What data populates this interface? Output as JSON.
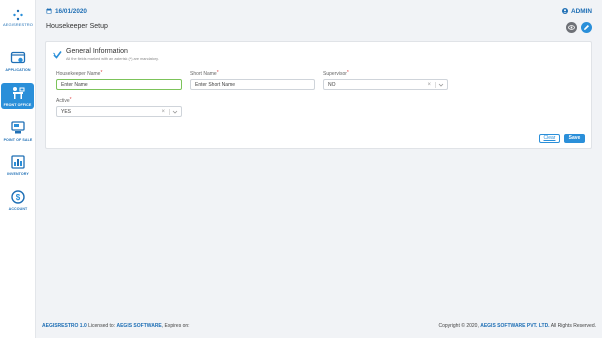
{
  "brand": {
    "name": "AEGISRESTRO"
  },
  "sidebar": {
    "items": [
      {
        "label": "APPLICATION",
        "icon": "application-window-icon",
        "active": false
      },
      {
        "label": "FRONT OFFICE",
        "icon": "front-office-desk-icon",
        "active": true
      },
      {
        "label": "POINT OF SALE",
        "icon": "pos-terminal-icon",
        "active": false
      },
      {
        "label": "INVENTORY",
        "icon": "inventory-chart-icon",
        "active": false
      },
      {
        "label": "ACCOUNT",
        "icon": "account-dollar-icon",
        "active": false
      }
    ]
  },
  "header": {
    "date": "16/01/2020",
    "user": "ADMIN",
    "page_title": "Housekeeper Setup"
  },
  "form": {
    "section_title": "General Information",
    "section_note": "All the fields marked with an asterisk (*) are mandatory.",
    "fields": {
      "housekeeper_name": {
        "label": "Housekeeper Name",
        "placeholder": "Enter Name",
        "required": "*"
      },
      "short_name": {
        "label": "Short Name",
        "placeholder": "Enter Short Name",
        "required": "*"
      },
      "supervisor": {
        "label": "Supervisor",
        "value": "NO",
        "required": "*"
      },
      "active": {
        "label": "Active",
        "value": "YES",
        "required": "*"
      }
    },
    "buttons": {
      "clear": "Clear",
      "save": "Save"
    }
  },
  "footer": {
    "product": "AEGISRESTRO 1.0",
    "licensed_text": "Licensed to:",
    "licensee": "AEGIS SOFTWARE",
    "expires_text": ", Expires on:",
    "copyright_text": "Copyright © 2020,",
    "company": "AEGIS SOFTWARE PVT. LTD.",
    "rights_text": "All Rights Reserved."
  },
  "colors": {
    "accent": "#2a8fd9",
    "brand_text": "#1f6fb5",
    "focus": "#7cc35a",
    "required": "#e24a4a"
  }
}
